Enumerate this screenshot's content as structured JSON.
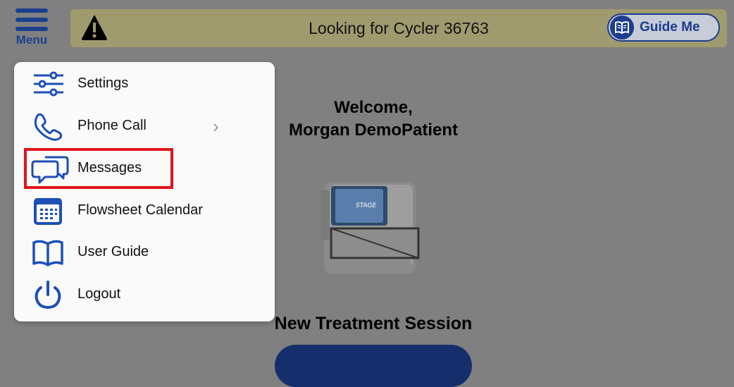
{
  "header": {
    "menu_label": "Menu",
    "status_text": "Looking for Cycler 36763",
    "guide_label": "Guide Me"
  },
  "welcome": {
    "line1": "Welcome,",
    "line2": "Morgan DemoPatient"
  },
  "device": {
    "brand": "STAGE"
  },
  "treatment": {
    "title": "New Treatment Session"
  },
  "menu": {
    "items": [
      {
        "label": "Settings",
        "icon": "settings-sliders-icon"
      },
      {
        "label": "Phone Call",
        "icon": "phone-icon"
      },
      {
        "label": "Messages",
        "icon": "messages-icon"
      },
      {
        "label": "Flowsheet Calendar",
        "icon": "calendar-icon"
      },
      {
        "label": "User Guide",
        "icon": "book-icon"
      },
      {
        "label": "Logout",
        "icon": "power-icon"
      }
    ]
  },
  "colors": {
    "brand_blue": "#1d3d8c",
    "highlight": "#e0141b",
    "banner": "#a09a6f",
    "overlay": "#808080"
  }
}
